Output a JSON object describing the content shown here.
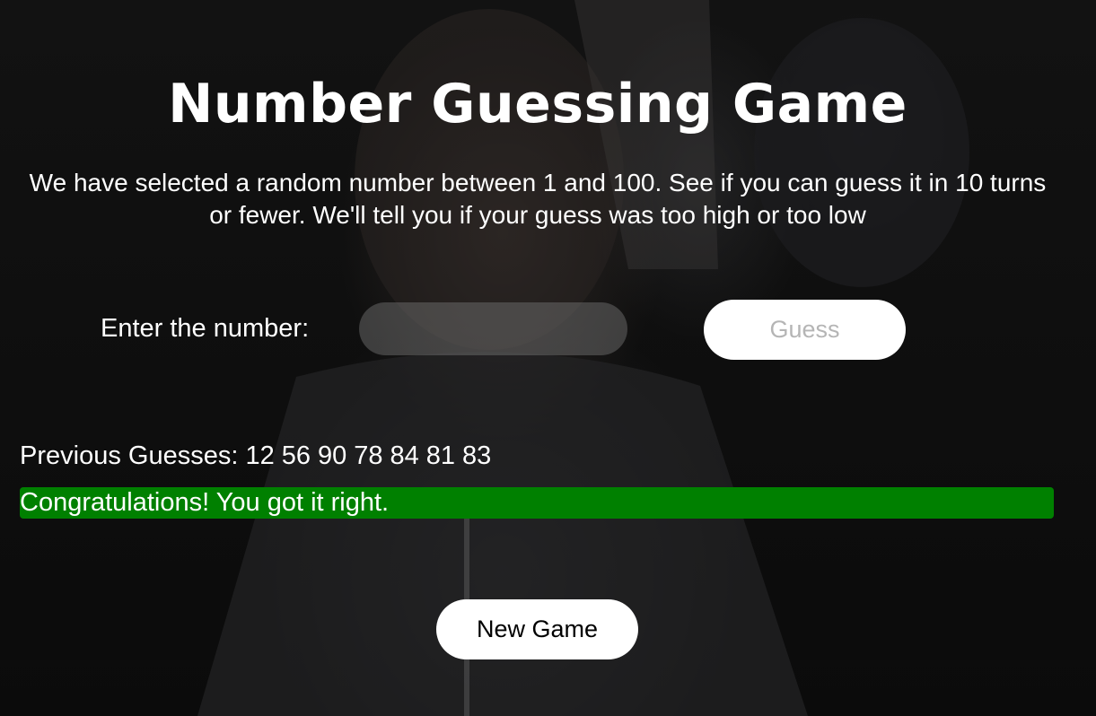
{
  "page": {
    "title": "Number Guessing Game",
    "intro": "We have selected a random number between 1 and 100. See if you can guess it in 10 turns or fewer. We'll tell you if your guess was too high or too low"
  },
  "guess_form": {
    "label": "Enter the number:",
    "input_value": "",
    "input_placeholder": "",
    "submit_label": "Guess"
  },
  "history": {
    "label": "Previous Guesses:",
    "values": [
      "12",
      "56",
      "90",
      "78",
      "84",
      "81",
      "83"
    ]
  },
  "result": {
    "message": "Congratulations! You got it right.",
    "color": "#008000"
  },
  "actions": {
    "new_game_label": "New Game"
  },
  "colors": {
    "background": "#0d0d0d",
    "text": "#ffffff",
    "button_bg": "#ffffff",
    "disabled_button_text": "#b5b5b5"
  }
}
